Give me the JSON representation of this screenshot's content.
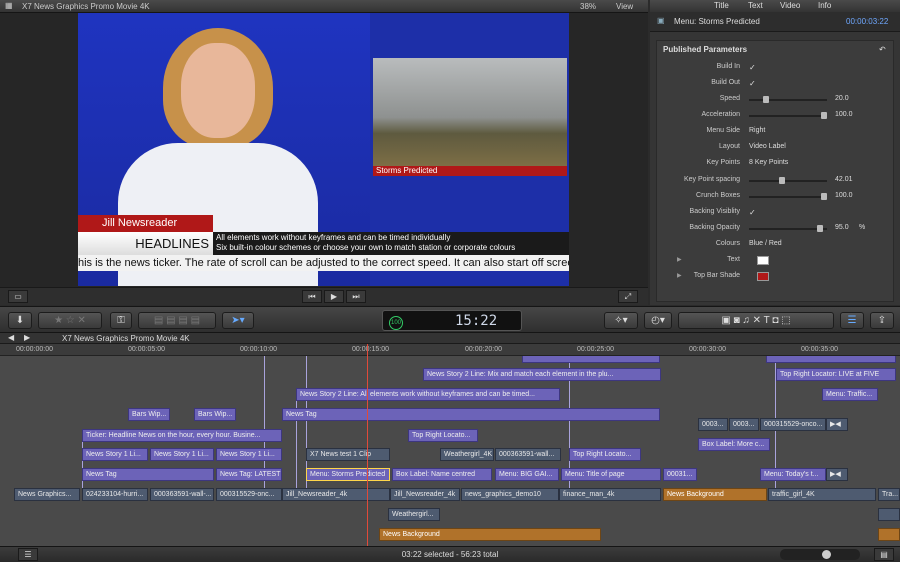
{
  "viewer": {
    "title": "X7 News Graphics Promo Movie 4K",
    "zoom": "38%",
    "view_menu": "View",
    "storm_label": "Storms Predicted",
    "name": "Jill Newsreader",
    "headline": "HEADLINES",
    "headline_line1": "All elements work without keyframes and can be timed  individually",
    "headline_line2": "Six built-in colour schemes or choose your own to match station or corporate colours",
    "ticker": "his is the news ticker. The rate of scroll can be adjusted to the correct speed. It can also start off screen or fa"
  },
  "inspector": {
    "tabs": [
      "Title",
      "Text",
      "Video",
      "Info"
    ],
    "clip_name": "Menu: Storms Predicted",
    "timecode": "00:00:03:22",
    "section": "Published Parameters",
    "params": {
      "build_in": "Build In",
      "build_out": "Build Out",
      "speed": "Speed",
      "speed_val": "20.0",
      "speed_level": 0.2,
      "accel": "Acceleration",
      "accel_val": "100.0",
      "accel_level": 1.0,
      "menu_side": "Menu Side",
      "menu_side_val": "Right",
      "layout": "Layout",
      "layout_val": "Video Label",
      "keypoints": "Key Points",
      "keypoints_val": "8 Key Points",
      "kp_spacing": "Key Point spacing",
      "kp_spacing_val": "42.01",
      "kp_spacing_level": 0.42,
      "crunch": "Crunch Boxes",
      "crunch_val": "100.0",
      "crunch_level": 1.0,
      "backing_vis": "Backing Visiblity",
      "backing_op": "Backing Opacity",
      "backing_op_val": "95.0",
      "backing_op_unit": "%",
      "backing_op_level": 0.95,
      "colours": "Colours",
      "colours_val": "Blue / Red",
      "text": "Text",
      "topbar": "Top Bar Shade",
      "check_mark": "✓"
    }
  },
  "colors": {
    "text_swatch": "#ffffff",
    "topbar_swatch": "#b01818"
  },
  "toolbar": {
    "timecode": "15:22",
    "pct": "100"
  },
  "timeline": {
    "title": "X7 News Graphics Promo Movie 4K",
    "ruler": [
      "00:00:00:00",
      "00:00:05:00",
      "00:00:10:00",
      "00:00:15:00",
      "00:00:20:00",
      "00:00:25:00",
      "00:00:30:00",
      "00:00:35:00"
    ],
    "clips": {
      "c1": "News Story 2 Line: Mix and match each element in the plu...",
      "c2": "Top Right Locator: LIVE at FIVE",
      "c3": "News Story 2 Line: All elements work without keyframes and can be timed...",
      "c4": "Menu: Traffic...",
      "c5": "Bars Wip...",
      "c6": "Bars Wip...",
      "c7": "News Tag",
      "c8": "0003...",
      "c9": "0003...",
      "c10": "000315529-onco...",
      "c11": "Ticker: Headline News on the hour, every hour.    Busine...",
      "c12": "Top Right Locato...",
      "c13": "Box Label: More c...",
      "c14": "News Story 1 Li...",
      "c15": "News Story 1 Li...",
      "c16": "News Story 1 Li...",
      "c17": "X7 News test 1 Clip",
      "c18": "Weathergirl_4K",
      "c19": "000363591-wall...",
      "c20": "Top Right Locato...",
      "c21": "News Tag",
      "c22": "News Tag: LATEST",
      "c23": "Menu: Storms Predicted",
      "c24": "Box Label: Name centred",
      "c25": "Menu: BIG GAI...",
      "c26": "Menu: Title of page",
      "c27": "00031...",
      "c28": "Menu: Today's t...",
      "v1": "News Graphics...",
      "v2": "024233104-hurri...",
      "v3": "000363591-wall-...",
      "v4": "000315529-onc...",
      "v5": "Jill_Newsreader_4k",
      "v6": "Jill_Newsreader_4k",
      "v7": "news_graphics_demo10",
      "v8": "finance_man_4k",
      "v9": "News Background",
      "v10": "traffic_girl_4K",
      "v11": "Tra...",
      "w1": "Weathergirl...",
      "a1": "News Background"
    }
  },
  "status": "03:22 selected - 56:23 total"
}
